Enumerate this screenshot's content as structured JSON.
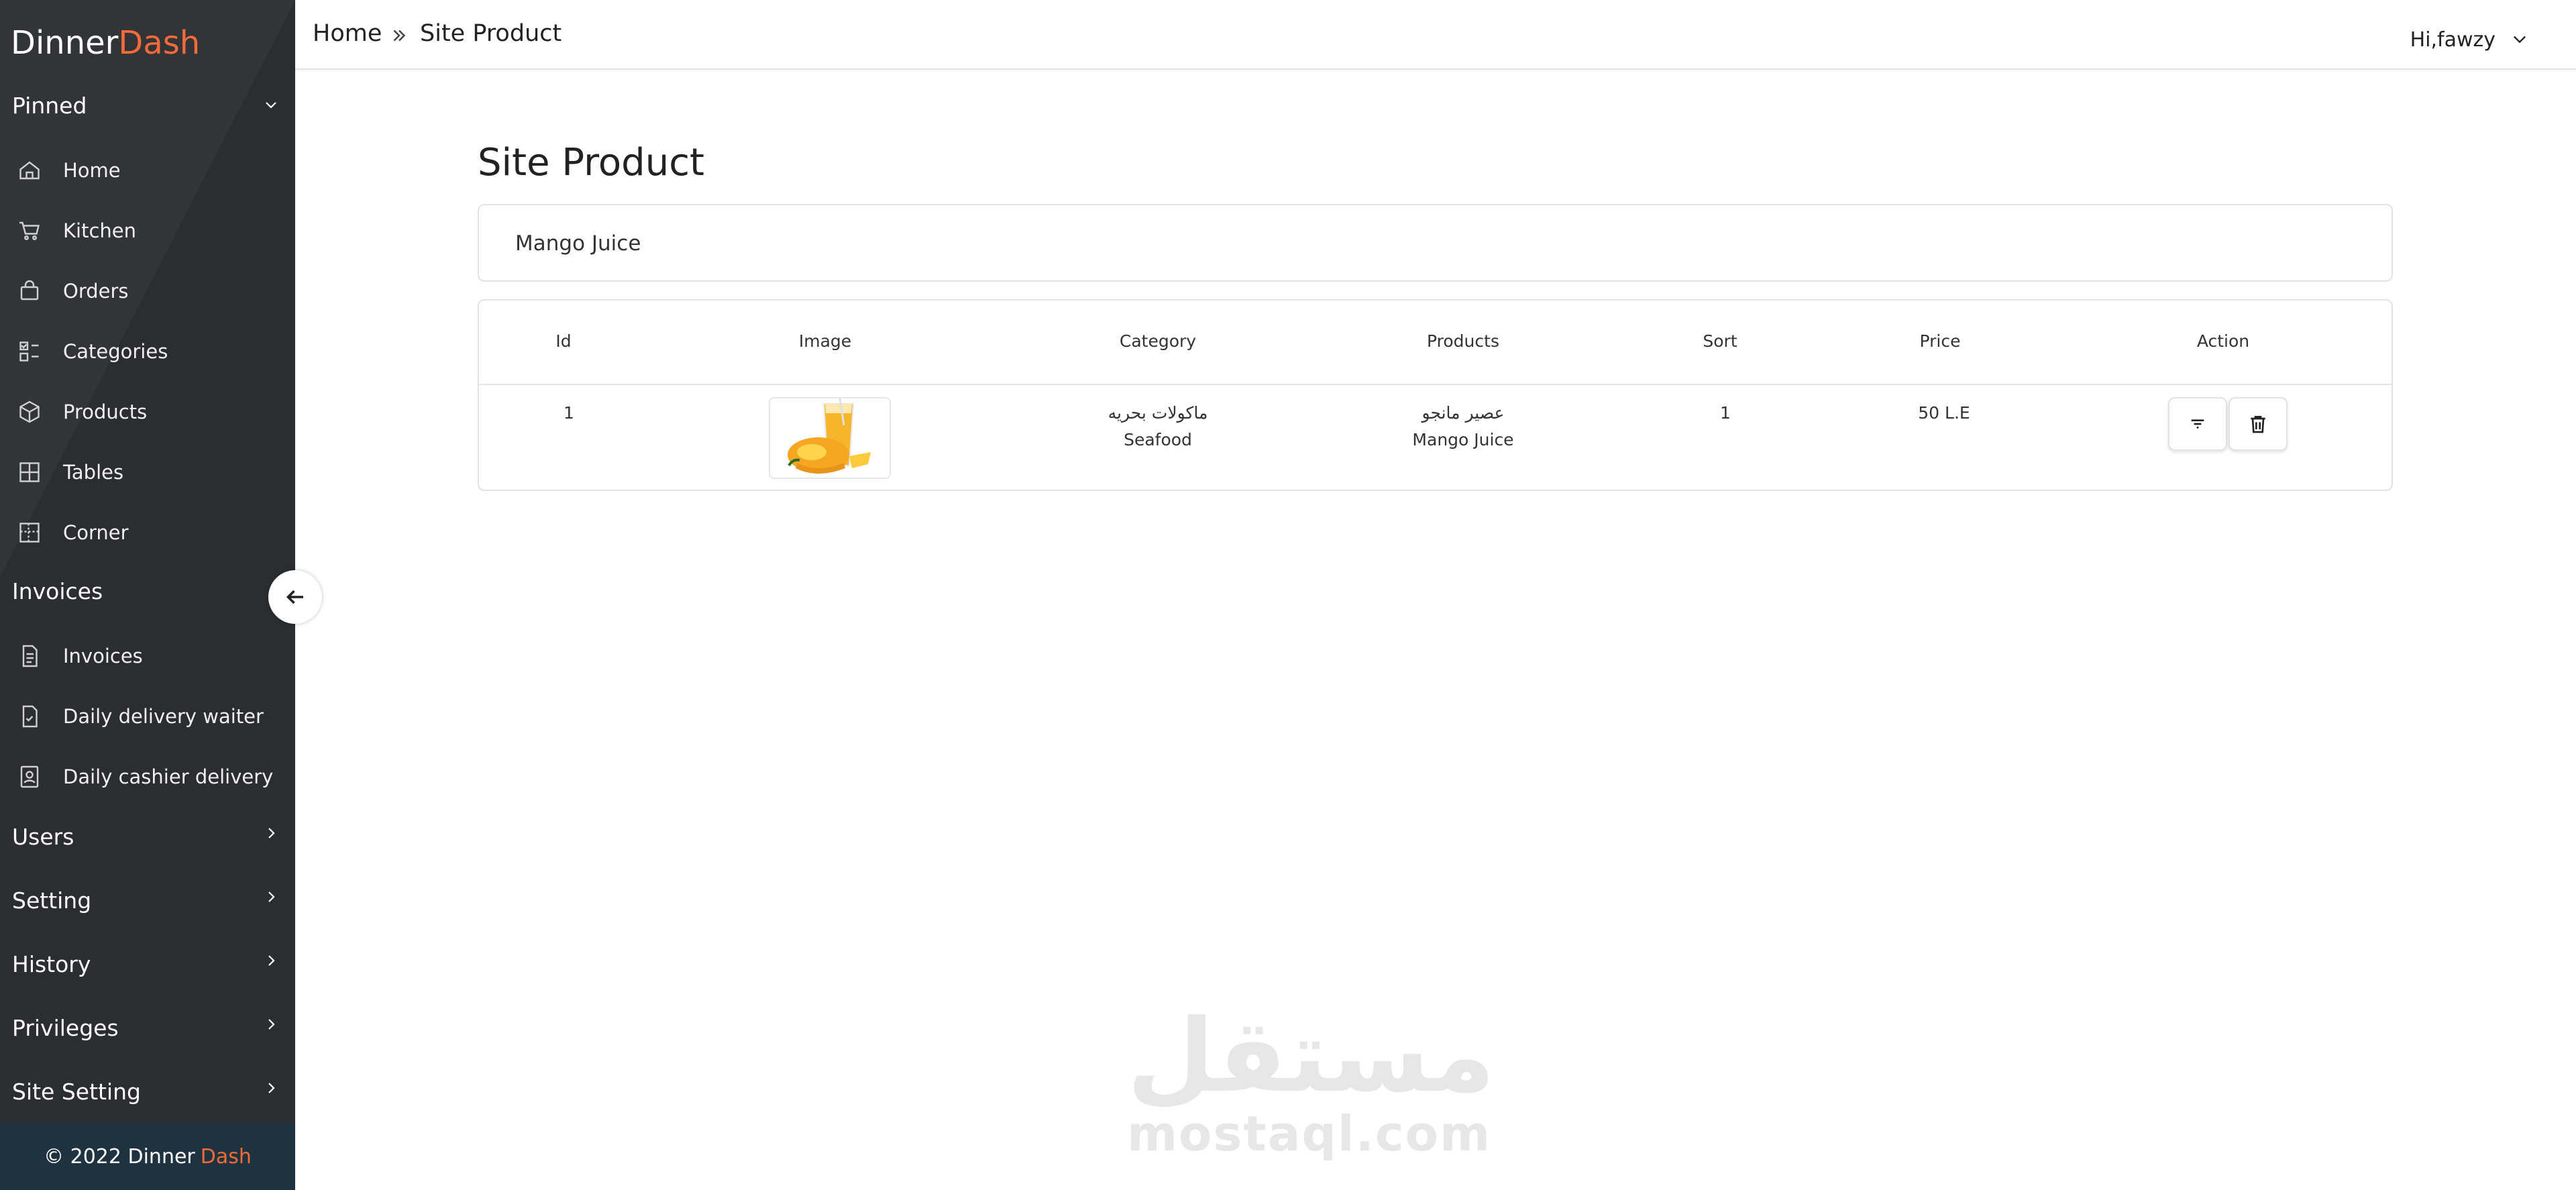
{
  "brand": {
    "name": "Dinner",
    "accent": "Dash"
  },
  "sidebar": {
    "pinned_title": "Pinned",
    "pinned_items": [
      {
        "label": "Home",
        "icon": "home-icon"
      },
      {
        "label": "Kitchen",
        "icon": "cart-icon"
      },
      {
        "label": "Orders",
        "icon": "bag-icon"
      },
      {
        "label": "Categories",
        "icon": "categories-icon"
      },
      {
        "label": "Products",
        "icon": "box-icon"
      },
      {
        "label": "Tables",
        "icon": "grid-icon"
      },
      {
        "label": "Corner",
        "icon": "corner-icon"
      }
    ],
    "invoices_title": "Invoices",
    "invoice_items": [
      {
        "label": "Invoices",
        "icon": "document-icon"
      },
      {
        "label": "Daily delivery waiter",
        "icon": "document-check-icon"
      },
      {
        "label": "Daily cashier delivery",
        "icon": "badge-icon"
      }
    ],
    "sections": [
      "Users",
      "Setting",
      "History",
      "Privileges",
      "Site Setting"
    ],
    "footer": {
      "text": "© 2022 Dinner",
      "accent": "Dash"
    }
  },
  "topbar": {
    "breadcrumb": [
      "Home",
      "Site Product"
    ],
    "user": "Hi,fawzy"
  },
  "main": {
    "title": "Site Product",
    "search_value": "Mango Juice",
    "table": {
      "columns": [
        "Id",
        "Image",
        "Category",
        "Products",
        "Sort",
        "Price",
        "Action"
      ],
      "rows": [
        {
          "id": "1",
          "category_ar": "ماكولات بحريه",
          "category_en": "Seafood",
          "product_ar": "عصير مانجو",
          "product_en": "Mango Juice",
          "sort": "1",
          "price": "50 L.E"
        }
      ]
    }
  },
  "watermark": {
    "ar": "مستقل",
    "en": "mostaql.com"
  },
  "colors": {
    "sidebar_bg": "#2b2d31",
    "accent": "#f26b38",
    "footer_bg": "#1f3240"
  }
}
